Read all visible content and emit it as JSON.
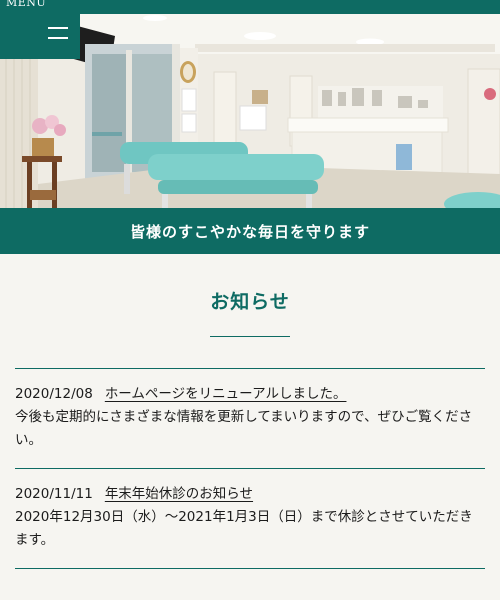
{
  "menu": {
    "label": "MENU",
    "icon": "hamburger-icon"
  },
  "hero": {
    "description_icon": "clinic-waiting-room-photo"
  },
  "tagline": "皆様のすこやかな毎日を守ります",
  "news": {
    "title": "お知らせ",
    "items": [
      {
        "date": "2020/12/08",
        "link": "ホームページをリニューアルしました。",
        "body": "今後も定期的にさまざまな情報を更新してまいりますので、ぜひご覧ください。"
      },
      {
        "date": "2020/11/11",
        "link": "年末年始休診のお知らせ",
        "body": "2020年12月30日（水）～2021年1月3日（日）まで休診とさせていただきます。"
      }
    ]
  },
  "colors": {
    "brand": "#0e6b63",
    "background": "#f6f5f1"
  }
}
